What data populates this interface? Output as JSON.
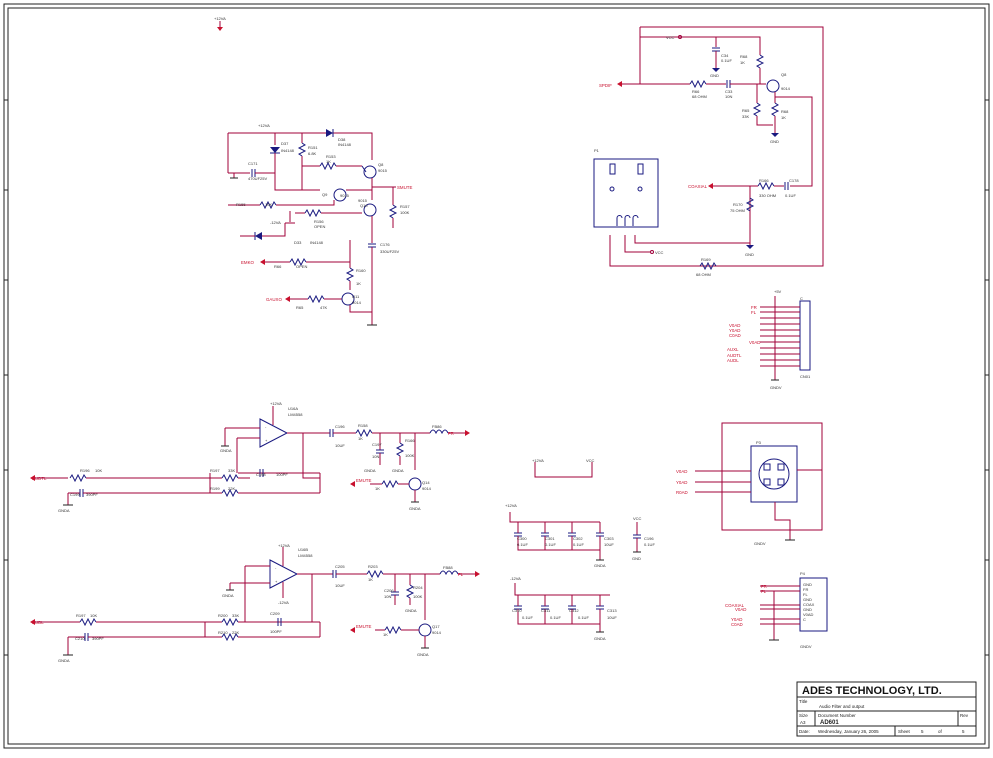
{
  "power": {
    "p12va": "+12VA",
    "vcc": "VCC",
    "p5v": "+5V",
    "m12va": "-12VA",
    "gnd": "GND",
    "gnda": "GNDA",
    "gndv": "GNDV"
  },
  "nets": {
    "spdif": "SPDIF",
    "coaxial": "COAXIAL",
    "smute": "SMUTE",
    "emko": "EMKO",
    "emute": "EMUTE",
    "gauxo": "GAUXO",
    "auxl": "AUXL",
    "audtl": "AUDTL",
    "audl": "AUDL",
    "pr": "PR",
    "pl": "PL",
    "fr": "FR",
    "fl": "FL",
    "v0ad": "V0AD",
    "y0ad": "Y0AD",
    "r0ad": "R0AD",
    "c0ad": "C0AD",
    "coax": "COAX",
    "c": "C"
  },
  "parts": {
    "u16a": "U16A",
    "u16b": "U16B",
    "lm4558": "LM4558",
    "q8": "Q8",
    "q9": "Q9",
    "q10": "Q10",
    "q11": "Q11",
    "q14": "Q14",
    "q17": "Q17",
    "d37": "D37",
    "d38": "D38",
    "d33": "D33",
    "in4148": "IN4148",
    "r151": "R151",
    "r153": "R153",
    "r154": "R154",
    "r155": "R155",
    "r156": "R156",
    "r157": "R157",
    "r158": "R158",
    "r160": "R160",
    "r166": "R166",
    "r170": "R170",
    "r65": "R65",
    "r66": "R66",
    "r68": "R68",
    "r169": "R169",
    "c171": "C171",
    "c176": "C176",
    "c33": "C33",
    "c34": "C34",
    "c178": "C178",
    "c196": "C196",
    "c197": "C197",
    "c209": "C209",
    "c205": "C205",
    "c300": "C300",
    "c301": "C301",
    "c302": "C302",
    "c303": "C303",
    "c310": "C310",
    "c311": "C311",
    "c312": "C312",
    "c313": "C313",
    "p1": "P1",
    "p3": "P3",
    "p4": "P4",
    "cn01": "CN01",
    "fb86": "FB86",
    "fb88": "FB88"
  },
  "values": {
    "k1": "1K",
    "k10": "10K",
    "k47": "47K",
    "k33": "33K",
    "k22": "22K",
    "k68": "6.8K",
    "k100": "100K",
    "k56": "5.6K",
    "ohm68": "68 OHM",
    "ohm330": "330 OHM",
    "ohm75": "75 OHM",
    "pf100": "100PF",
    "pf390": "390PF",
    "uf1": "0.1UF",
    "uf10": "10UF",
    "uf470": "470UF25V",
    "uf330": "330UF25V",
    "n10": "10N",
    "open": "OPEN",
    "q9014": "9014",
    "q9015": "9015"
  },
  "title_block": {
    "company": "ADES TECHNOLOGY, LTD.",
    "title_label": "Title",
    "title": "Audio Filter and output",
    "size_label": "Size",
    "size": "A3",
    "docnum_label": "Document Number",
    "docnum": "AD601",
    "rev_label": "Rev",
    "date_label": "Date:",
    "date": "Wednesday, January 26, 2005",
    "sheet_label": "Sheet",
    "sheet": "5",
    "of_label": "of",
    "of": "5"
  },
  "colors": {
    "wire": "#a0003a",
    "part": "#1a1a80",
    "net": "#c8102e",
    "border": "#222222"
  }
}
